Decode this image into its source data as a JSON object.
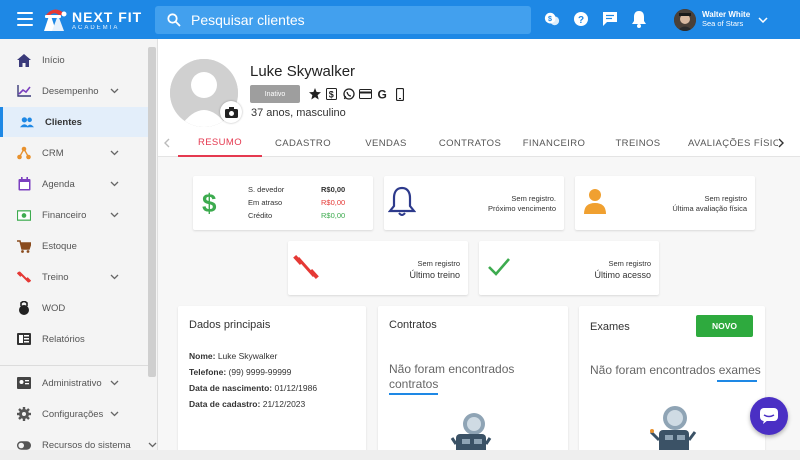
{
  "app": {
    "logo_line1": "NEXT FIT",
    "logo_line2": "ACADEMIA",
    "search_placeholder": "Pesquisar clientes",
    "user_name": "Walter White",
    "user_org": "Sea of Stars",
    "brand_color": "#1e88e5",
    "accent_color": "#e53950"
  },
  "sidebar": {
    "items": [
      {
        "label": "Início",
        "icon": "home-icon"
      },
      {
        "label": "Desempenho",
        "icon": "chart-line-icon"
      },
      {
        "label": "Clientes",
        "icon": "users-icon"
      },
      {
        "label": "CRM",
        "icon": "crm-icon"
      },
      {
        "label": "Agenda",
        "icon": "calendar-icon"
      },
      {
        "label": "Financeiro",
        "icon": "money-icon"
      },
      {
        "label": "Estoque",
        "icon": "cart-icon"
      },
      {
        "label": "Treino",
        "icon": "dumbbell-icon"
      },
      {
        "label": "WOD",
        "icon": "kettlebell-icon"
      },
      {
        "label": "Relatórios",
        "icon": "report-icon"
      },
      {
        "label": "Administrativo",
        "icon": "admin-icon"
      },
      {
        "label": "Configurações",
        "icon": "gear-icon"
      },
      {
        "label": "Recursos do sistema",
        "icon": "toggle-icon"
      }
    ]
  },
  "client": {
    "name": "Luke Skywalker",
    "status": "Inativo",
    "age_gender": "37 anos, masculino"
  },
  "tabs": [
    "RESUMO",
    "CADASTRO",
    "VENDAS",
    "CONTRATOS",
    "FINANCEIRO",
    "TREINOS",
    "AVALIAÇÕES FÍSICA"
  ],
  "summary": {
    "s_devedor_label": "S. devedor",
    "s_devedor_value": "R$0,00",
    "em_atraso_label": "Em atraso",
    "em_atraso_value": "R$0,00",
    "credito_label": "Crédito",
    "credito_value": "R$0,00",
    "vencimento_status": "Sem registro.",
    "vencimento_label": "Próximo vencimento",
    "avaliacao_status": "Sem registro",
    "avaliacao_label": "Última avaliação física",
    "treino_status": "Sem registro",
    "treino_label": "Último treino",
    "acesso_status": "Sem registro",
    "acesso_label": "Último acesso"
  },
  "dados": {
    "title": "Dados principais",
    "nome_label": "Nome:",
    "nome": "Luke Skywalker",
    "telefone_label": "Telefone:",
    "telefone": "(99) 9999-99999",
    "nascimento_label": "Data de nascimento:",
    "nascimento": "01/12/1986",
    "cadastro_label": "Data de cadastro:",
    "cadastro": "21/12/2023"
  },
  "contratos": {
    "title": "Contratos",
    "empty_l1": "Não foram encontrados",
    "empty_l2": "contratos"
  },
  "exames": {
    "title": "Exames",
    "new_button": "NOVO",
    "empty": "Não foram encontrados exames"
  }
}
